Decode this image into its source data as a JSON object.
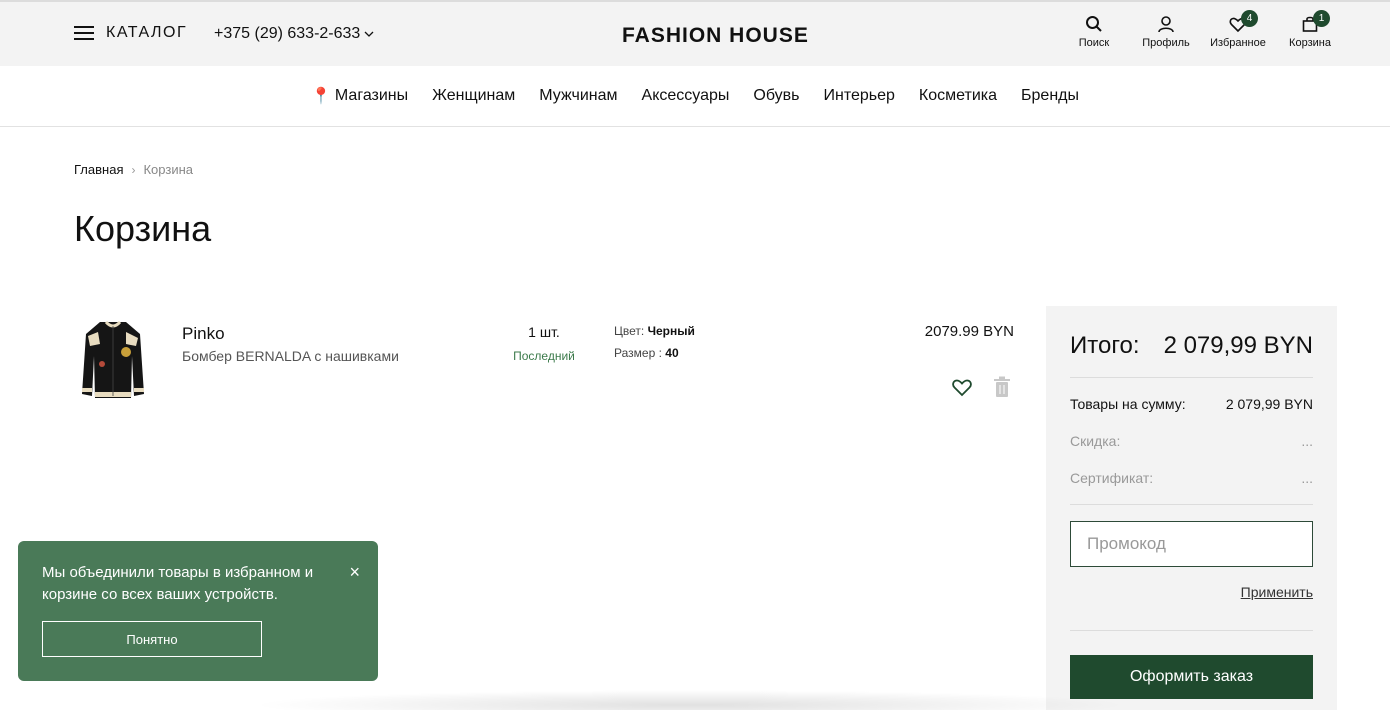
{
  "header": {
    "catalog_label": "КАТАЛОГ",
    "phone": "+375 (29) 633-2-633",
    "logo": "FASHION HOUSE",
    "icons": {
      "search": "Поиск",
      "profile": "Профиль",
      "favorites": "Избранное",
      "favorites_count": "4",
      "cart": "Корзина",
      "cart_count": "1"
    }
  },
  "nav": {
    "stores": "Магазины",
    "women": "Женщинам",
    "men": "Мужчинам",
    "accessories": "Аксессуары",
    "shoes": "Обувь",
    "interior": "Интерьер",
    "cosmetics": "Косметика",
    "brands": "Бренды"
  },
  "breadcrumb": {
    "home": "Главная",
    "current": "Корзина"
  },
  "page_title": "Корзина",
  "cart_item": {
    "brand": "Pinko",
    "name": "Бомбер BERNALDA с нашивками",
    "quantity": "1 шт.",
    "stock_note": "Последний",
    "color_label": "Цвет:",
    "color_value": "Черный",
    "size_label": "Размер :",
    "size_value": "40",
    "price": "2079.99 BYN"
  },
  "summary": {
    "total_label": "Итого:",
    "total_value": "2 079,99 BYN",
    "goods_label": "Товары на сумму:",
    "goods_value": "2 079,99 BYN",
    "discount_label": "Скидка:",
    "discount_value": "...",
    "certificate_label": "Сертификат:",
    "certificate_value": "...",
    "promo_placeholder": "Промокод",
    "apply_label": "Применить",
    "checkout_label": "Оформить заказ"
  },
  "toast": {
    "text": "Мы объединили товары в избранном и корзине со всех ваших устройств.",
    "button": "Понятно",
    "close": "×"
  },
  "colors": {
    "accent": "#1f4a2e",
    "toast": "#4a7a58",
    "stock": "#3b7a4a"
  }
}
